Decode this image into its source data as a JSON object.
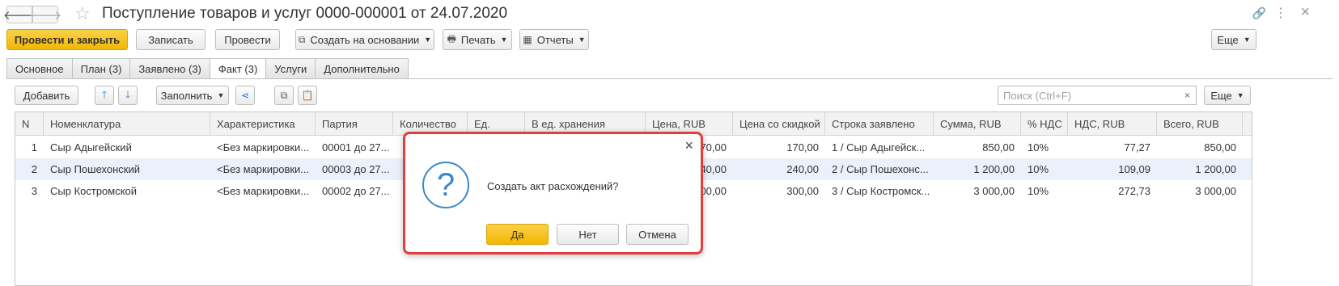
{
  "window": {
    "title": "Поступление товаров и услуг 0000-000001 от 24.07.2020"
  },
  "commands": {
    "post_close": "Провести и закрыть",
    "save": "Записать",
    "post": "Провести",
    "create_based": "Создать на основании",
    "print": "Печать",
    "reports": "Отчеты",
    "more": "Еще"
  },
  "tabs": [
    {
      "label": "Основное"
    },
    {
      "label": "План (3)"
    },
    {
      "label": "Заявлено (3)"
    },
    {
      "label": "Факт (3)",
      "active": true
    },
    {
      "label": "Услуги"
    },
    {
      "label": "Дополнительно"
    }
  ],
  "table_toolbar": {
    "add": "Добавить",
    "fill": "Заполнить",
    "search_placeholder": "Поиск (Ctrl+F)",
    "more": "Еще"
  },
  "table": {
    "columns": [
      "N",
      "Номенклатура",
      "Характеристика",
      "Партия",
      "Количество",
      "Ед.",
      "В ед. хранения",
      "Цена, RUB",
      "Цена со скидкой",
      "Строка заявлено",
      "Сумма, RUB",
      "% НДС",
      "НДС, RUB",
      "Всего, RUB"
    ],
    "rows": [
      {
        "n": "1",
        "item": "Сыр Адыгейский",
        "char": "<Без маркировки...",
        "batch": "00001 до 27...",
        "qty": "",
        "unit": "",
        "store_unit": "",
        "price": "70,00",
        "price_disc": "170,00",
        "declared": "1 / Сыр Адыгейск...",
        "sum": "850,00",
        "vat_pct": "10%",
        "vat": "77,27",
        "total": "850,00"
      },
      {
        "n": "2",
        "item": "Сыр Пошехонский",
        "char": "<Без маркировки...",
        "batch": "00003 до 27...",
        "qty": "",
        "unit": "",
        "store_unit": "",
        "price": "40,00",
        "price_disc": "240,00",
        "declared": "2 / Сыр Пошехонс...",
        "sum": "1 200,00",
        "vat_pct": "10%",
        "vat": "109,09",
        "total": "1 200,00"
      },
      {
        "n": "3",
        "item": "Сыр Костромской",
        "char": "<Без маркировки...",
        "batch": "00002 до 27...",
        "qty": "",
        "unit": "",
        "store_unit": "",
        "price": "00,00",
        "price_disc": "300,00",
        "declared": "3 / Сыр Костромск...",
        "sum": "3 000,00",
        "vat_pct": "10%",
        "vat": "272,73",
        "total": "3 000,00"
      }
    ]
  },
  "dialog": {
    "message": "Создать акт расхождений?",
    "yes": "Да",
    "no": "Нет",
    "cancel": "Отмена"
  }
}
